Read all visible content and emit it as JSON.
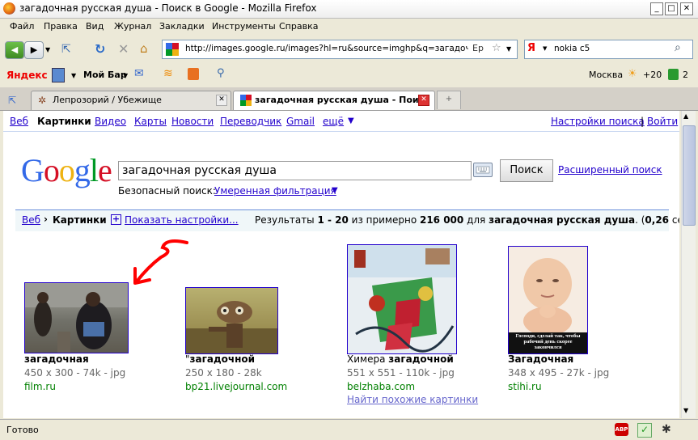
{
  "window": {
    "title": "загадочная русская душа - Поиск в Google - Mozilla Firefox"
  },
  "menu": [
    "Файл",
    "Правка",
    "Вид",
    "Журнал",
    "Закладки",
    "Инструменты",
    "Справка"
  ],
  "nav": {
    "url": "http://images.google.ru/images?hl=ru&source=imghp&q=загадочная+",
    "search_value": "nokia c5",
    "lang_badge": "Ep"
  },
  "yandex_bar": {
    "brand": "Яндекс",
    "my_bar": "Мой Бар",
    "city": "Москва",
    "temp": "+20",
    "count": "2"
  },
  "tabs": [
    {
      "label": "Лепрозорий / Убежище"
    },
    {
      "label": "загадочная русская душа - Пои..."
    }
  ],
  "gbar": {
    "links": [
      "Веб",
      "Картинки",
      "Видео",
      "Карты",
      "Новости",
      "Переводчик",
      "Gmail",
      "ещё"
    ],
    "settings": "Настройки поиска",
    "signin": "Войти",
    "sep": "|"
  },
  "search": {
    "logo": "Google",
    "query": "загадочная русская душа",
    "button": "Поиск",
    "advanced": "Расширенный поиск",
    "safe_label": "Безопасный поиск:",
    "safe_value": "Умеренная фильтрация"
  },
  "resultsbar": {
    "web": "Веб",
    "arrow": "›",
    "images": "Картинки",
    "show_settings": "Показать настройки...",
    "summary_prefix": "Результаты ",
    "range": "1 - 20",
    "summary_mid": " из примерно ",
    "count": "216 000",
    "summary_for": " для ",
    "query": "загадочная русская душа",
    "time_prefix": ". (",
    "time": "0,26",
    "time_suffix": " сек.)"
  },
  "results": [
    {
      "caption_pre": "",
      "caption_bold": "загадочная",
      "meta": "450 x 300 - 74k - jpg",
      "site": "film.ru"
    },
    {
      "caption_pre": "\"",
      "caption_bold": "загадочной",
      "meta": "250 x 180 - 28k",
      "site": "bp21.livejournal.com"
    },
    {
      "caption_pre": "Химера ",
      "caption_bold": "загадочной",
      "meta": "551 x 551 - 110k - jpg",
      "site": "belzhaba.com",
      "similar": "Найти похожие картинки"
    },
    {
      "caption_pre": "",
      "caption_bold": "Загадочная",
      "meta": "348 x 495 - 27k - jpg",
      "site": "stihi.ru",
      "image_caption": "Господи, сделай так, чтобы рабочий день скорее закончился"
    }
  ],
  "status": {
    "text": "Готово",
    "abp": "ABP"
  },
  "colors": {
    "link": "#2200cc",
    "green_url": "#008000",
    "annotation_arrow": "#ff0000"
  }
}
